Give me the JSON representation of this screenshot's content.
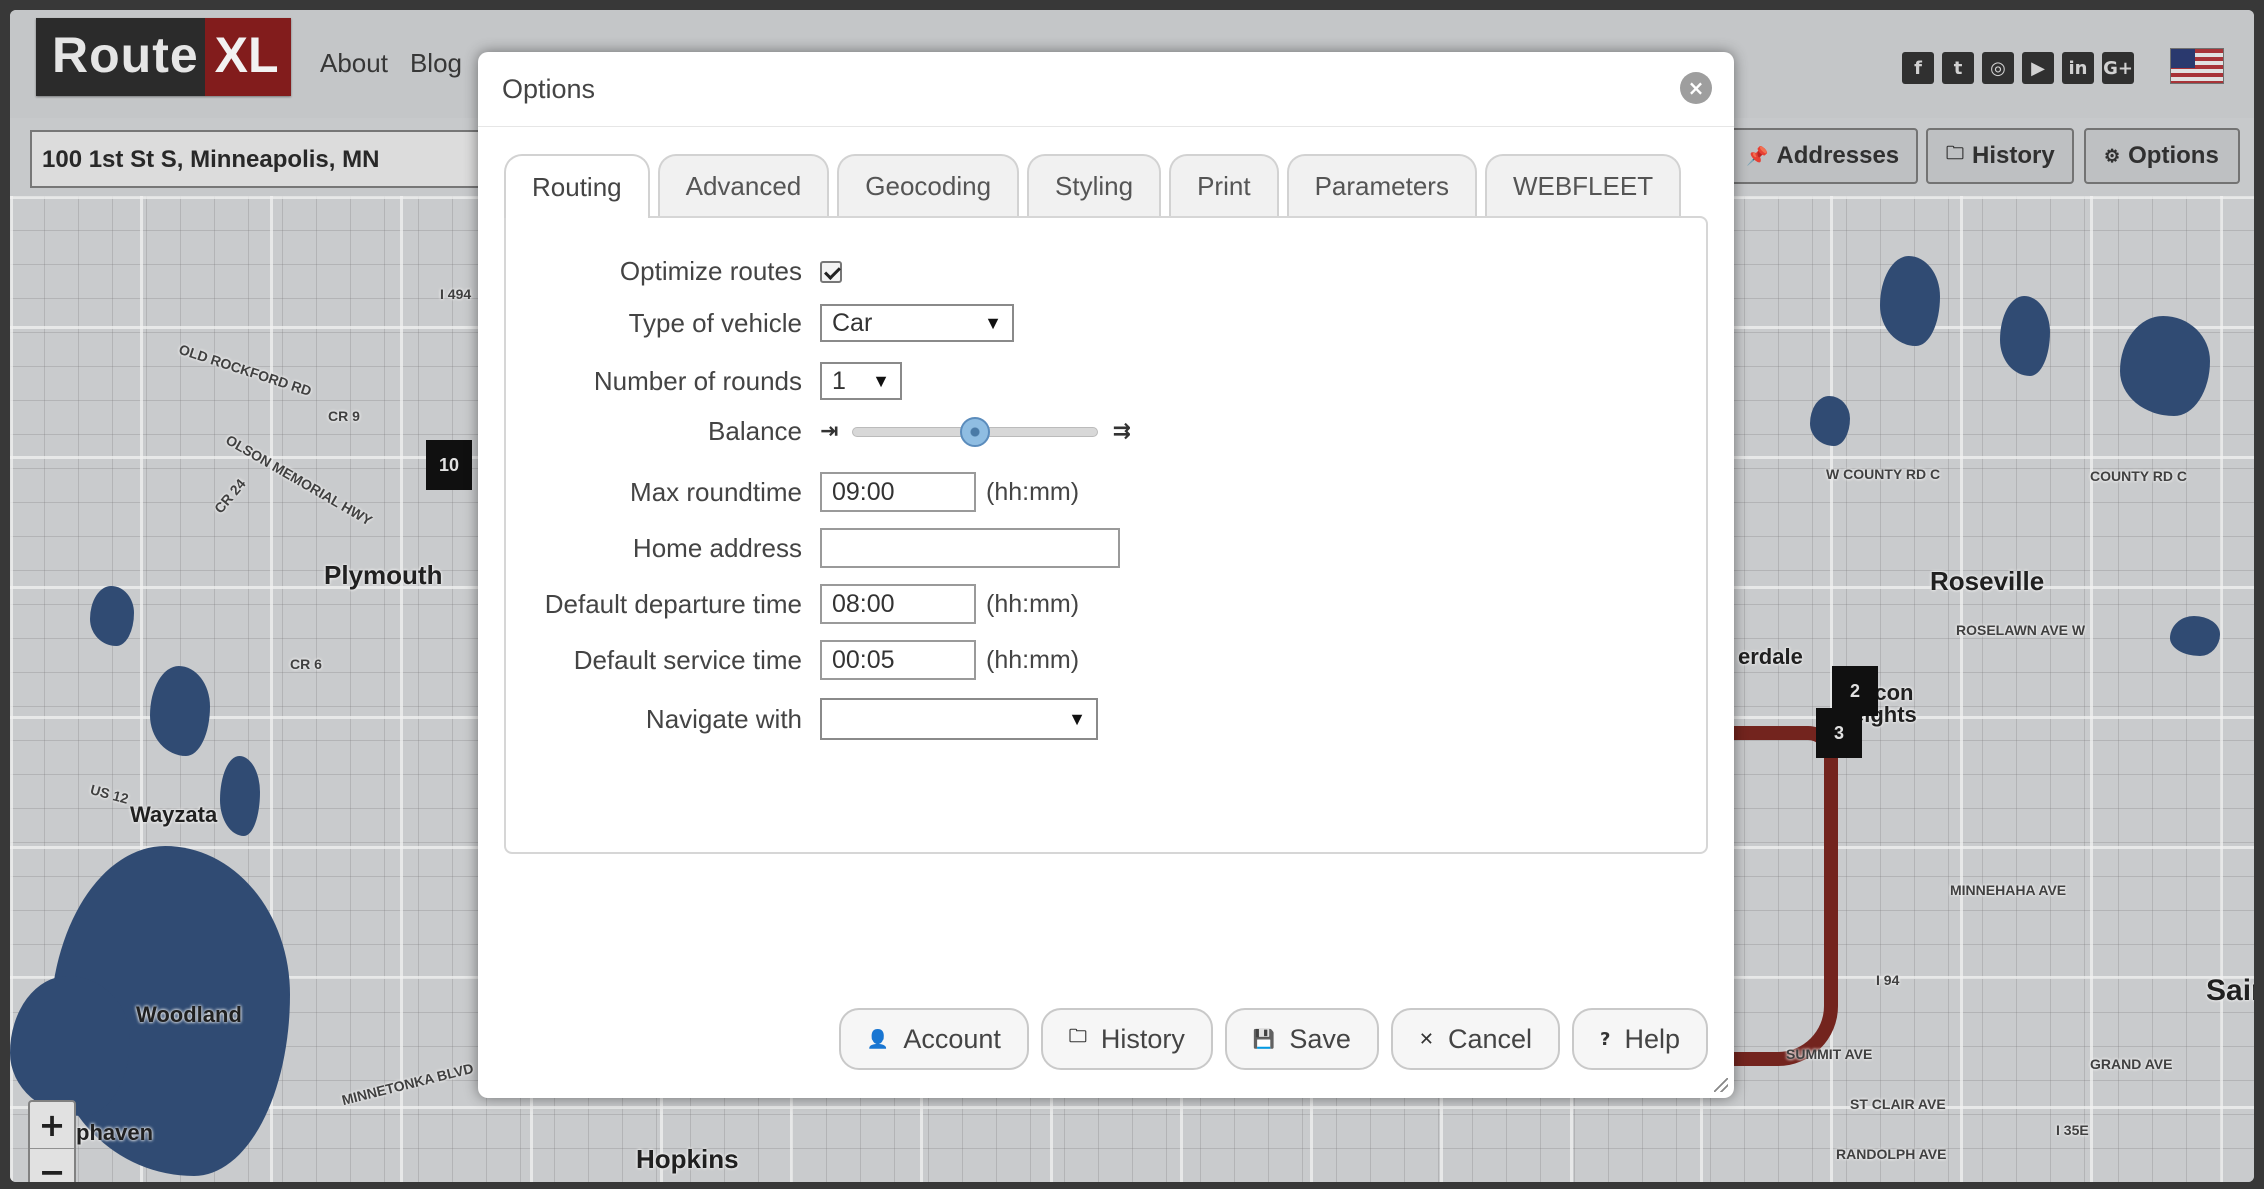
{
  "app": {
    "logo": {
      "part1": "Route",
      "part2": "XL"
    },
    "nav": [
      "About",
      "Blog"
    ],
    "social_icons": [
      "facebook-icon",
      "twitter-icon",
      "instagram-icon",
      "youtube-icon",
      "linkedin-icon",
      "googleplus-icon"
    ],
    "social_glyphs": [
      "f",
      "t",
      "◎",
      "▶",
      "in",
      "G+"
    ],
    "address_value": "100 1st St S, Minneapolis, MN",
    "toolbar": {
      "addresses": {
        "icon": "📌",
        "label": "Addresses"
      },
      "history": {
        "icon": "🗀",
        "label": "History"
      },
      "options": {
        "icon": "⚙",
        "label": "Options"
      }
    },
    "map": {
      "labels": [
        "Plymouth",
        "Wayzata",
        "Woodland",
        "Hopkins",
        "Roseville",
        "Sair"
      ],
      "partial_labels": [
        "erdale",
        "alcon",
        "eights",
        "phaven"
      ],
      "road_labels": [
        "OLD ROCKFORD RD",
        "CR 9",
        "OLSON MEMORIAL HWY",
        "CR 24",
        "CR 6",
        "US 12",
        "I 494",
        "MINNETONKA BLVD",
        "W COUNTY RD C",
        "ROSELAWN AVE W",
        "MINNEHAHA AVE",
        "I 94",
        "COUNTY RD C",
        "ST CLAIR AVE",
        "RANDOLPH AVE",
        "I 35E",
        "GRAND AVE",
        "SUMMIT AVE"
      ],
      "markers": [
        "10",
        "2",
        "3"
      ],
      "colors": {
        "route": "#7a2620",
        "water": "#33507a"
      }
    },
    "zoom": {
      "in": "+",
      "out": "−"
    }
  },
  "dialog": {
    "title": "Options",
    "close_glyph": "×",
    "tabs": [
      {
        "label": "Routing",
        "active": true
      },
      {
        "label": "Advanced",
        "active": false
      },
      {
        "label": "Geocoding",
        "active": false
      },
      {
        "label": "Styling",
        "active": false
      },
      {
        "label": "Print",
        "active": false
      },
      {
        "label": "Parameters",
        "active": false
      },
      {
        "label": "WEBFLEET",
        "active": false
      }
    ],
    "routing": {
      "optimize": {
        "label": "Optimize routes",
        "checked": true
      },
      "vehicle": {
        "label": "Type of vehicle",
        "value": "Car"
      },
      "rounds": {
        "label": "Number of rounds",
        "value": "1"
      },
      "balance": {
        "label": "Balance",
        "value_fraction": 0.5,
        "icon_left": "⇥",
        "icon_right": "⇉"
      },
      "max_roundtime": {
        "label": "Max roundtime",
        "value": "09:00",
        "hint": "(hh:mm)"
      },
      "home_address": {
        "label": "Home address",
        "value": ""
      },
      "departure": {
        "label": "Default departure time",
        "value": "08:00",
        "hint": "(hh:mm)"
      },
      "service": {
        "label": "Default service time",
        "value": "00:05",
        "hint": "(hh:mm)"
      },
      "navigate": {
        "label": "Navigate with",
        "value": ""
      }
    },
    "select_arrow": "▼",
    "buttons": {
      "account": {
        "icon": "👤",
        "label": "Account"
      },
      "history": {
        "icon": "🗀",
        "label": "History"
      },
      "save": {
        "icon": "💾",
        "label": "Save"
      },
      "cancel": {
        "icon": "✕",
        "label": "Cancel"
      },
      "help": {
        "icon": "?",
        "label": "Help"
      }
    }
  }
}
